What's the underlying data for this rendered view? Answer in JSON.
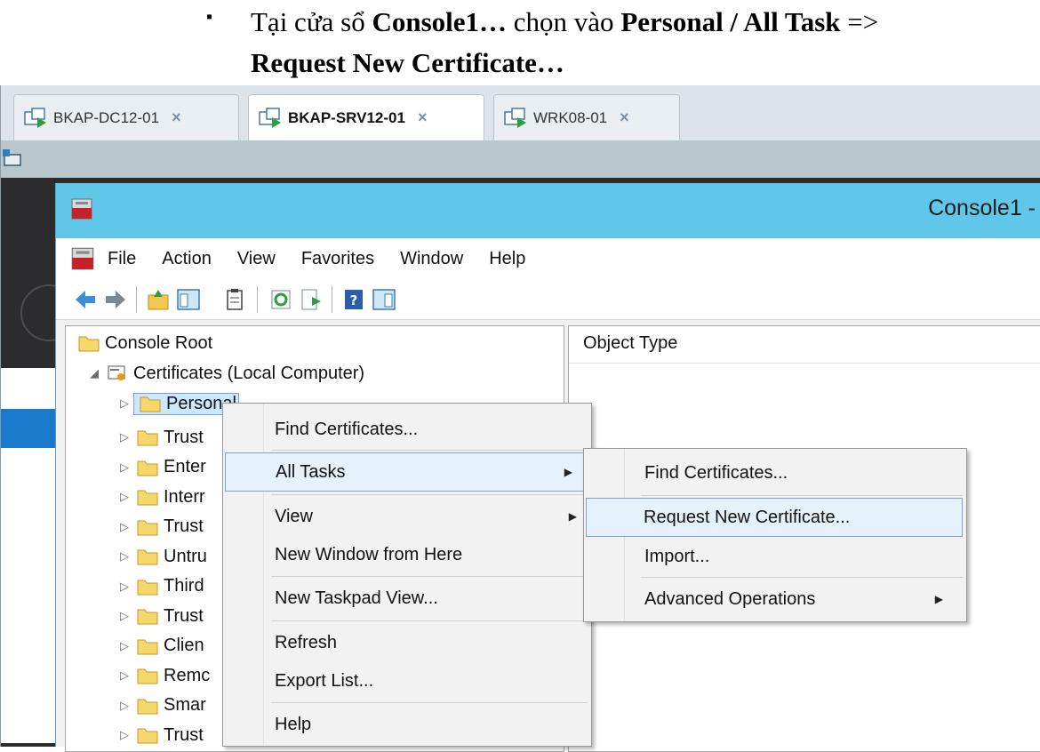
{
  "instruction": {
    "bullet": "▪",
    "p1": "Tại cửa sổ ",
    "b1": "Console1…",
    "p2": " chọn vào ",
    "b2": "Personal / All Task",
    "p3": " => ",
    "b3": "Request New Certificate…"
  },
  "host_tabs": [
    {
      "label": "BKAP-DC12-01",
      "close": "×"
    },
    {
      "label": "BKAP-SRV12-01",
      "close": "×"
    },
    {
      "label": "WRK08-01",
      "close": "×"
    }
  ],
  "mmc": {
    "title": "Console1 -",
    "menu": [
      "File",
      "Action",
      "View",
      "Favorites",
      "Window",
      "Help"
    ],
    "results_header": "Object Type",
    "tree": {
      "root": "Console Root",
      "certs": "Certificates (Local Computer)",
      "personal": "Personal",
      "children": [
        "Trust",
        "Enter",
        "Interr",
        "Trust",
        "Untru",
        "Third",
        "Trust",
        "Clien",
        "Remc",
        "Smar",
        "Trust"
      ]
    }
  },
  "context_menu": {
    "items": [
      "Find Certificates...",
      "All Tasks",
      "View",
      "New Window from Here",
      "New Taskpad View...",
      "Refresh",
      "Export List...",
      "Help"
    ]
  },
  "submenu": {
    "items": [
      "Find Certificates...",
      "Request New Certificate...",
      "Import...",
      "Advanced Operations"
    ]
  },
  "colors": {
    "title_bar": "#61c7e8",
    "menu_highlight": "#e5f1fb",
    "highlight_border": "#7da2ce"
  }
}
